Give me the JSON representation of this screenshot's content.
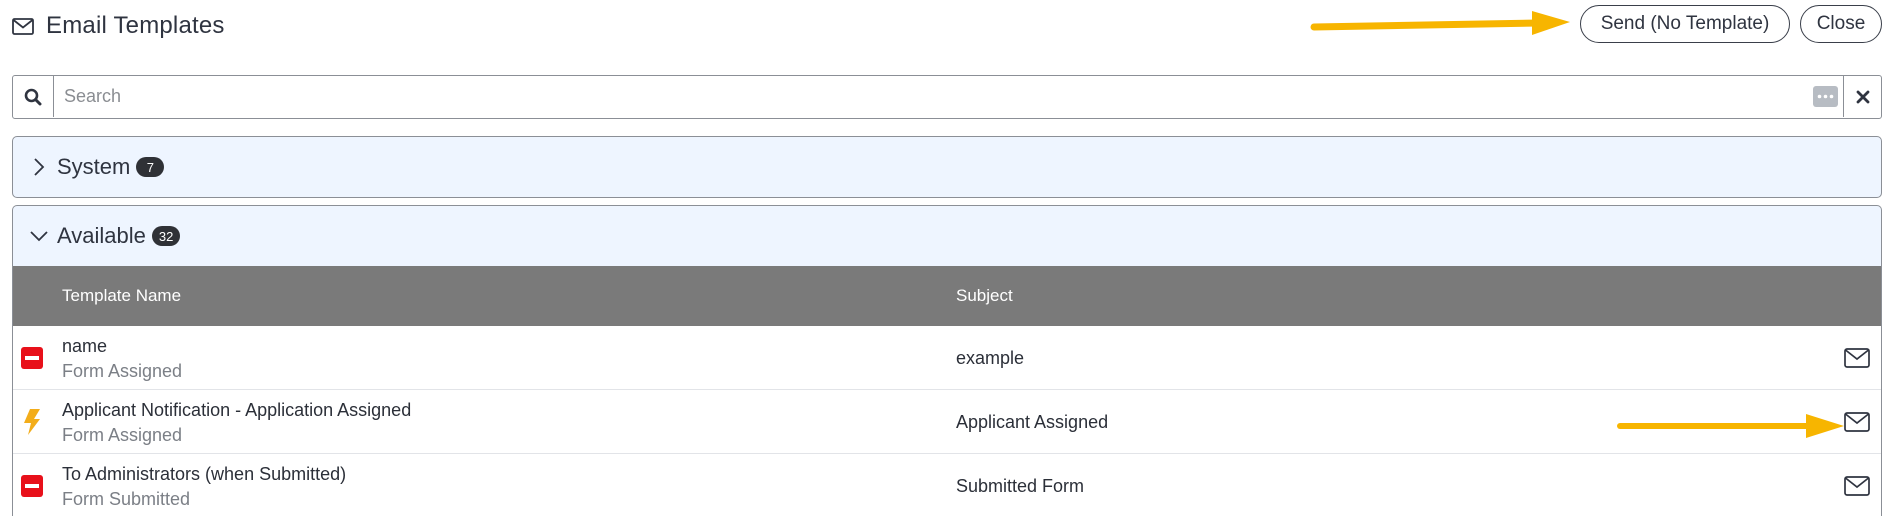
{
  "header": {
    "title": "Email Templates",
    "title_icon": "envelope-icon",
    "send_no_template_label": "Send (No Template)",
    "close_label": "Close"
  },
  "search": {
    "placeholder": "Search",
    "value": ""
  },
  "groups": [
    {
      "label": "System",
      "count": "7",
      "expanded": false
    },
    {
      "label": "Available",
      "count": "32",
      "expanded": true
    }
  ],
  "table": {
    "columns": [
      "Template Name",
      "Subject"
    ],
    "rows": [
      {
        "name": "name",
        "event": "Form Assigned",
        "subject": "example",
        "status_icon": "minus-circle-icon",
        "status_color": "#e8101a"
      },
      {
        "name": "Applicant Notification - Application Assigned",
        "event": "Form Assigned",
        "subject": "Applicant Assigned",
        "status_icon": "lightning-bolt-icon",
        "status_color": "#f3ad1a"
      },
      {
        "name": "To Administrators (when Submitted)",
        "event": "Form Submitted",
        "subject": "Submitted Form",
        "status_icon": "minus-circle-icon",
        "status_color": "#e8101a"
      }
    ]
  },
  "colors": {
    "annotation_arrow": "#f7b500",
    "group_background": "#eef5ff",
    "table_header": "#7a7a7a"
  }
}
